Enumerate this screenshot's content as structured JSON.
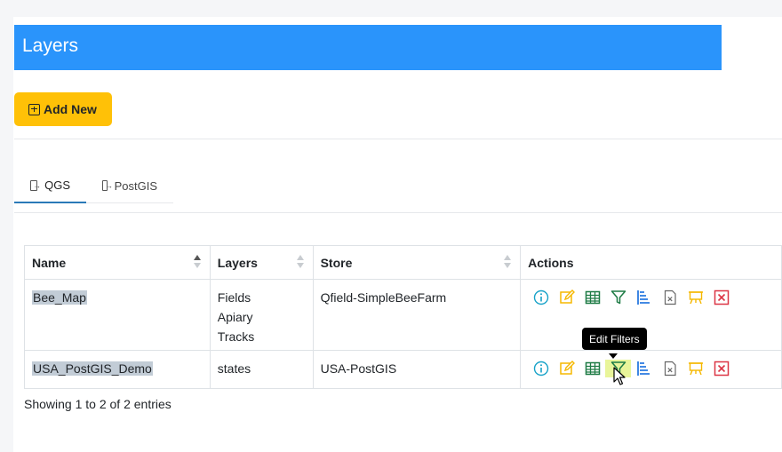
{
  "page": {
    "title": "Layers"
  },
  "toolbar": {
    "add_label": "Add New"
  },
  "tabs": [
    {
      "label": "QGS",
      "active": true,
      "icon": "arrow-in-box-icon"
    },
    {
      "label": "PostGIS",
      "active": false,
      "icon": "arrow-in-box-icon"
    }
  ],
  "table": {
    "headers": [
      "Name",
      "Layers",
      "Store",
      "Actions"
    ],
    "rows": [
      {
        "name": "Bee_Map",
        "layers": [
          "Fields",
          "Apiary",
          "Tracks"
        ],
        "store": "Qfield-SimpleBeeFarm"
      },
      {
        "name": "USA_PostGIS_Demo",
        "layers": [
          "states"
        ],
        "store": "USA-PostGIS"
      }
    ],
    "action_icons": [
      "info-icon",
      "edit-icon",
      "table-icon",
      "filter-icon",
      "tree-list-icon",
      "file-x-icon",
      "easel-icon",
      "delete-icon"
    ]
  },
  "tooltip": {
    "text": "Edit Filters"
  },
  "footer": {
    "info": "Showing 1 to 2 of 2 entries"
  },
  "colors": {
    "header": "#2a94fb",
    "add_button": "#ffc107",
    "info": "#17a2c8",
    "edit": "#f5b800",
    "table": "#1e7b45",
    "filter": "#1e7b45",
    "tree": "#2a7ae0",
    "delete": "#dc3545"
  }
}
